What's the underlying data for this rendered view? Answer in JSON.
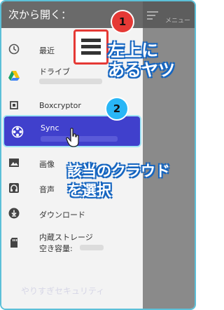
{
  "drawer": {
    "header": "次から開く：",
    "items": [
      {
        "label": "最近",
        "icon": "clock-icon"
      },
      {
        "label": "ドライブ",
        "icon": "google-drive-icon"
      },
      {
        "label": "Boxcryptor",
        "icon": "boxcryptor-icon"
      },
      {
        "label": "Sync",
        "icon": "sync-icon"
      },
      {
        "label": "画像",
        "icon": "image-icon"
      },
      {
        "label": "音声",
        "icon": "headphones-icon"
      },
      {
        "label": "ダウンロード",
        "icon": "download-icon"
      },
      {
        "label": "内蔵ストレージ",
        "sublabel": "空き容量:",
        "icon": "sd-card-icon"
      }
    ],
    "watermark": "やりすぎセキュリティ"
  },
  "app": {
    "menu_label": "メニュー"
  },
  "annotations": {
    "step1": "1",
    "step2": "2",
    "callout1_line1": "左上に",
    "callout1_line2": "あるヤツ",
    "callout2_line1": "該当のクラウド",
    "callout2_line2": "を選択"
  },
  "colors": {
    "selected": "#4040cc",
    "badge_red": "#e53935",
    "badge_blue": "#29b6f6",
    "callout_outline": "#1565c0"
  }
}
